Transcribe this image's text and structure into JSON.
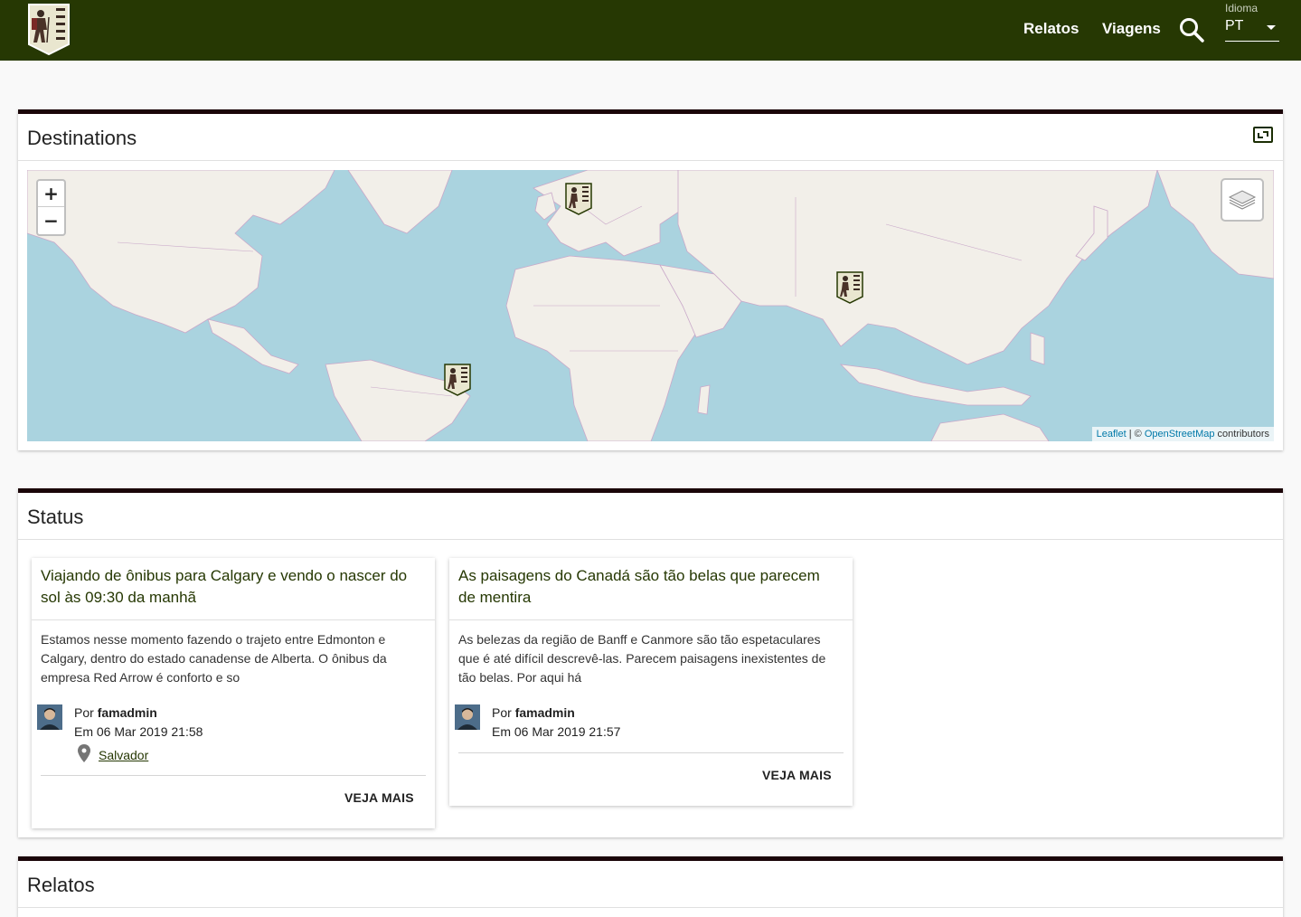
{
  "header": {
    "logo_icon": "hiker-logo-icon",
    "nav": [
      {
        "label": "Relatos"
      },
      {
        "label": "Viagens"
      }
    ],
    "search_icon": "search-icon",
    "language": {
      "label": "Idioma",
      "value": "PT"
    }
  },
  "destinations": {
    "title": "Destinations",
    "fullscreen_icon": "fullscreen-icon",
    "map": {
      "zoom_in": "+",
      "zoom_out": "−",
      "layers_icon": "layers-icon",
      "attribution": {
        "leaflet": "Leaflet",
        "separator": " | © ",
        "osm": "OpenStreetMap",
        "suffix": " contributors"
      },
      "marker_icon": "hiker-marker-icon"
    }
  },
  "status": {
    "title": "Status",
    "cards": [
      {
        "title": "Viajando de ônibus para Calgary e vendo o nascer do sol às 09:30 da manhã",
        "excerpt": "Estamos nesse momento fazendo o trajeto entre Edmonton e Calgary, dentro do estado canadense de Alberta. O ônibus da empresa Red Arrow é conforto e so",
        "by": "Por ",
        "author": "famadmin",
        "date": "Em 06 Mar 2019 21:58",
        "place": "Salvador",
        "more": "VEJA MAIS"
      },
      {
        "title": "As paisagens do Canadá são tão belas que parecem de mentira",
        "excerpt": "As belezas da região de Banff e Canmore são tão espetaculares que é até difícil descrevê-las. Parecem paisagens inexistentes de tão belas. Por aqui há",
        "by": "Por ",
        "author": "famadmin",
        "date": "Em 06 Mar 2019 21:57",
        "more": "VEJA MAIS"
      }
    ]
  },
  "relatos": {
    "title": "Relatos"
  },
  "colors": {
    "header_bg": "#263803",
    "panel_border": "#1a0508",
    "ocean": "#aad3df",
    "land": "#f2efe9",
    "link": "#263803"
  }
}
